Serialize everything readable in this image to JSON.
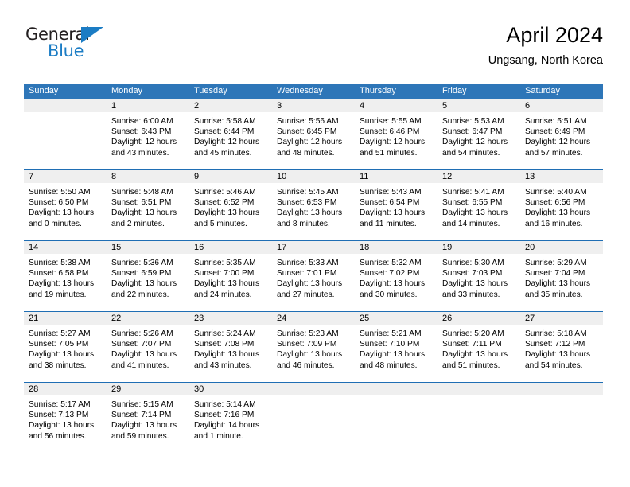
{
  "logo": {
    "line1": "General",
    "line2": "Blue",
    "triangle_color": "#1b7cc4"
  },
  "header": {
    "title": "April 2024",
    "subtitle": "Ungsang, North Korea"
  },
  "colors": {
    "header_blue": "#2e76b8",
    "separator_blue": "#1f6eb4",
    "date_strip_gray": "#efefef"
  },
  "weekdays": [
    "Sunday",
    "Monday",
    "Tuesday",
    "Wednesday",
    "Thursday",
    "Friday",
    "Saturday"
  ],
  "weeks": [
    [
      {
        "day": ""
      },
      {
        "day": "1",
        "sunrise": "Sunrise: 6:00 AM",
        "sunset": "Sunset: 6:43 PM",
        "daylight1": "Daylight: 12 hours",
        "daylight2": "and 43 minutes."
      },
      {
        "day": "2",
        "sunrise": "Sunrise: 5:58 AM",
        "sunset": "Sunset: 6:44 PM",
        "daylight1": "Daylight: 12 hours",
        "daylight2": "and 45 minutes."
      },
      {
        "day": "3",
        "sunrise": "Sunrise: 5:56 AM",
        "sunset": "Sunset: 6:45 PM",
        "daylight1": "Daylight: 12 hours",
        "daylight2": "and 48 minutes."
      },
      {
        "day": "4",
        "sunrise": "Sunrise: 5:55 AM",
        "sunset": "Sunset: 6:46 PM",
        "daylight1": "Daylight: 12 hours",
        "daylight2": "and 51 minutes."
      },
      {
        "day": "5",
        "sunrise": "Sunrise: 5:53 AM",
        "sunset": "Sunset: 6:47 PM",
        "daylight1": "Daylight: 12 hours",
        "daylight2": "and 54 minutes."
      },
      {
        "day": "6",
        "sunrise": "Sunrise: 5:51 AM",
        "sunset": "Sunset: 6:49 PM",
        "daylight1": "Daylight: 12 hours",
        "daylight2": "and 57 minutes."
      }
    ],
    [
      {
        "day": "7",
        "sunrise": "Sunrise: 5:50 AM",
        "sunset": "Sunset: 6:50 PM",
        "daylight1": "Daylight: 13 hours",
        "daylight2": "and 0 minutes."
      },
      {
        "day": "8",
        "sunrise": "Sunrise: 5:48 AM",
        "sunset": "Sunset: 6:51 PM",
        "daylight1": "Daylight: 13 hours",
        "daylight2": "and 2 minutes."
      },
      {
        "day": "9",
        "sunrise": "Sunrise: 5:46 AM",
        "sunset": "Sunset: 6:52 PM",
        "daylight1": "Daylight: 13 hours",
        "daylight2": "and 5 minutes."
      },
      {
        "day": "10",
        "sunrise": "Sunrise: 5:45 AM",
        "sunset": "Sunset: 6:53 PM",
        "daylight1": "Daylight: 13 hours",
        "daylight2": "and 8 minutes."
      },
      {
        "day": "11",
        "sunrise": "Sunrise: 5:43 AM",
        "sunset": "Sunset: 6:54 PM",
        "daylight1": "Daylight: 13 hours",
        "daylight2": "and 11 minutes."
      },
      {
        "day": "12",
        "sunrise": "Sunrise: 5:41 AM",
        "sunset": "Sunset: 6:55 PM",
        "daylight1": "Daylight: 13 hours",
        "daylight2": "and 14 minutes."
      },
      {
        "day": "13",
        "sunrise": "Sunrise: 5:40 AM",
        "sunset": "Sunset: 6:56 PM",
        "daylight1": "Daylight: 13 hours",
        "daylight2": "and 16 minutes."
      }
    ],
    [
      {
        "day": "14",
        "sunrise": "Sunrise: 5:38 AM",
        "sunset": "Sunset: 6:58 PM",
        "daylight1": "Daylight: 13 hours",
        "daylight2": "and 19 minutes."
      },
      {
        "day": "15",
        "sunrise": "Sunrise: 5:36 AM",
        "sunset": "Sunset: 6:59 PM",
        "daylight1": "Daylight: 13 hours",
        "daylight2": "and 22 minutes."
      },
      {
        "day": "16",
        "sunrise": "Sunrise: 5:35 AM",
        "sunset": "Sunset: 7:00 PM",
        "daylight1": "Daylight: 13 hours",
        "daylight2": "and 24 minutes."
      },
      {
        "day": "17",
        "sunrise": "Sunrise: 5:33 AM",
        "sunset": "Sunset: 7:01 PM",
        "daylight1": "Daylight: 13 hours",
        "daylight2": "and 27 minutes."
      },
      {
        "day": "18",
        "sunrise": "Sunrise: 5:32 AM",
        "sunset": "Sunset: 7:02 PM",
        "daylight1": "Daylight: 13 hours",
        "daylight2": "and 30 minutes."
      },
      {
        "day": "19",
        "sunrise": "Sunrise: 5:30 AM",
        "sunset": "Sunset: 7:03 PM",
        "daylight1": "Daylight: 13 hours",
        "daylight2": "and 33 minutes."
      },
      {
        "day": "20",
        "sunrise": "Sunrise: 5:29 AM",
        "sunset": "Sunset: 7:04 PM",
        "daylight1": "Daylight: 13 hours",
        "daylight2": "and 35 minutes."
      }
    ],
    [
      {
        "day": "21",
        "sunrise": "Sunrise: 5:27 AM",
        "sunset": "Sunset: 7:05 PM",
        "daylight1": "Daylight: 13 hours",
        "daylight2": "and 38 minutes."
      },
      {
        "day": "22",
        "sunrise": "Sunrise: 5:26 AM",
        "sunset": "Sunset: 7:07 PM",
        "daylight1": "Daylight: 13 hours",
        "daylight2": "and 41 minutes."
      },
      {
        "day": "23",
        "sunrise": "Sunrise: 5:24 AM",
        "sunset": "Sunset: 7:08 PM",
        "daylight1": "Daylight: 13 hours",
        "daylight2": "and 43 minutes."
      },
      {
        "day": "24",
        "sunrise": "Sunrise: 5:23 AM",
        "sunset": "Sunset: 7:09 PM",
        "daylight1": "Daylight: 13 hours",
        "daylight2": "and 46 minutes."
      },
      {
        "day": "25",
        "sunrise": "Sunrise: 5:21 AM",
        "sunset": "Sunset: 7:10 PM",
        "daylight1": "Daylight: 13 hours",
        "daylight2": "and 48 minutes."
      },
      {
        "day": "26",
        "sunrise": "Sunrise: 5:20 AM",
        "sunset": "Sunset: 7:11 PM",
        "daylight1": "Daylight: 13 hours",
        "daylight2": "and 51 minutes."
      },
      {
        "day": "27",
        "sunrise": "Sunrise: 5:18 AM",
        "sunset": "Sunset: 7:12 PM",
        "daylight1": "Daylight: 13 hours",
        "daylight2": "and 54 minutes."
      }
    ],
    [
      {
        "day": "28",
        "sunrise": "Sunrise: 5:17 AM",
        "sunset": "Sunset: 7:13 PM",
        "daylight1": "Daylight: 13 hours",
        "daylight2": "and 56 minutes."
      },
      {
        "day": "29",
        "sunrise": "Sunrise: 5:15 AM",
        "sunset": "Sunset: 7:14 PM",
        "daylight1": "Daylight: 13 hours",
        "daylight2": "and 59 minutes."
      },
      {
        "day": "30",
        "sunrise": "Sunrise: 5:14 AM",
        "sunset": "Sunset: 7:16 PM",
        "daylight1": "Daylight: 14 hours",
        "daylight2": "and 1 minute."
      },
      {
        "day": ""
      },
      {
        "day": ""
      },
      {
        "day": ""
      },
      {
        "day": ""
      }
    ]
  ]
}
